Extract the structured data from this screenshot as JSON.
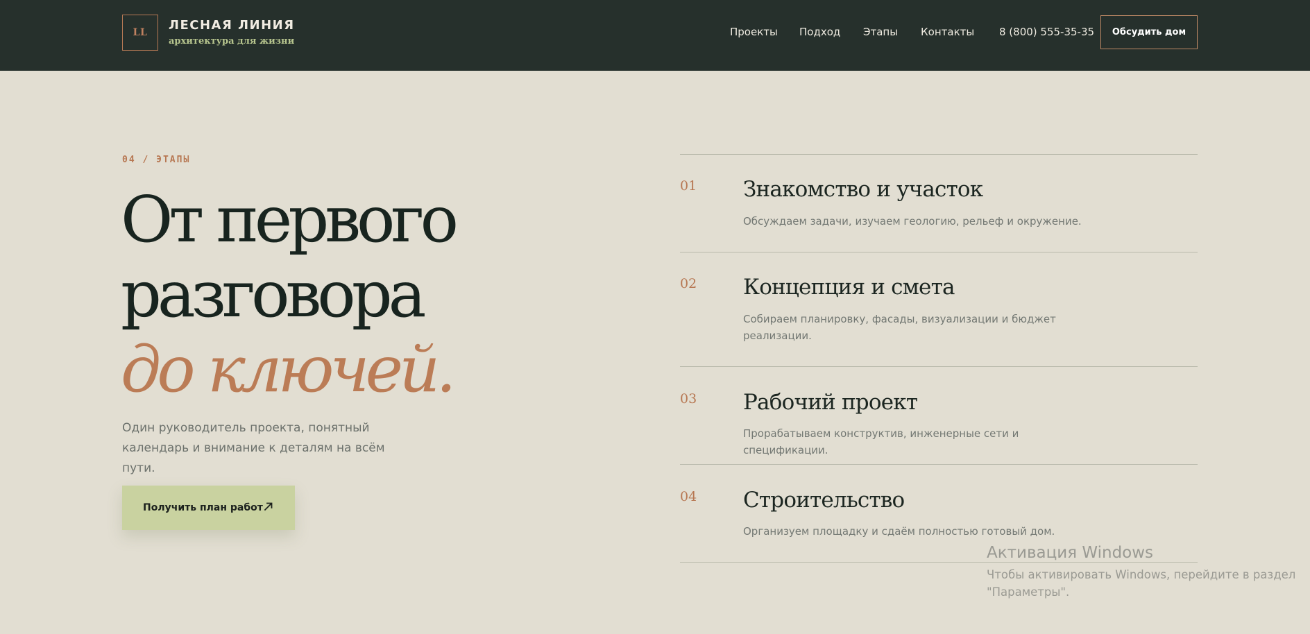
{
  "header": {
    "logo_mark": "LL",
    "brand_name": "ЛЕСНАЯ ЛИНИЯ",
    "brand_tagline": "архитектура для жизни",
    "nav": [
      {
        "label": "Проекты"
      },
      {
        "label": "Подход"
      },
      {
        "label": "Этапы"
      },
      {
        "label": "Контакты"
      }
    ],
    "phone": "8 (800) 555-35-35",
    "cta_label": "Обсудить дом"
  },
  "hero": {
    "eyebrow": "04 / ЭТАПЫ",
    "headline_line1": "От первого",
    "headline_line2": "разговора",
    "headline_accent": "до ключей.",
    "lead": "Один руководитель проекта, понятный календарь и внимание к деталям на всём пути.",
    "cta_label": "Получить план работ",
    "cta_icon": "arrow-up-right-icon"
  },
  "steps": [
    {
      "num": "01",
      "title": "Знакомство и участок",
      "desc": "Обсуждаем задачи, изучаем геологию, рельеф и окружение."
    },
    {
      "num": "02",
      "title": "Концепция и смета",
      "desc": "Собираем планировку, фасады, визуализации и бюджет реализации."
    },
    {
      "num": "03",
      "title": "Рабочий проект",
      "desc": "Прорабатываем конструктив, инженерные сети и спецификации."
    },
    {
      "num": "04",
      "title": "Строительство",
      "desc": "Организуем площадку и сдаём полностью готовый дом."
    }
  ],
  "watermark": {
    "title": "Активация Windows",
    "line1": "Чтобы активировать Windows, перейдите в раздел",
    "line2": "\"Параметры\"."
  },
  "colors": {
    "header_bg": "#26302c",
    "page_bg": "#e2ded2",
    "accent_copper": "#bb7c56",
    "cta_green": "#c9d2a0"
  }
}
